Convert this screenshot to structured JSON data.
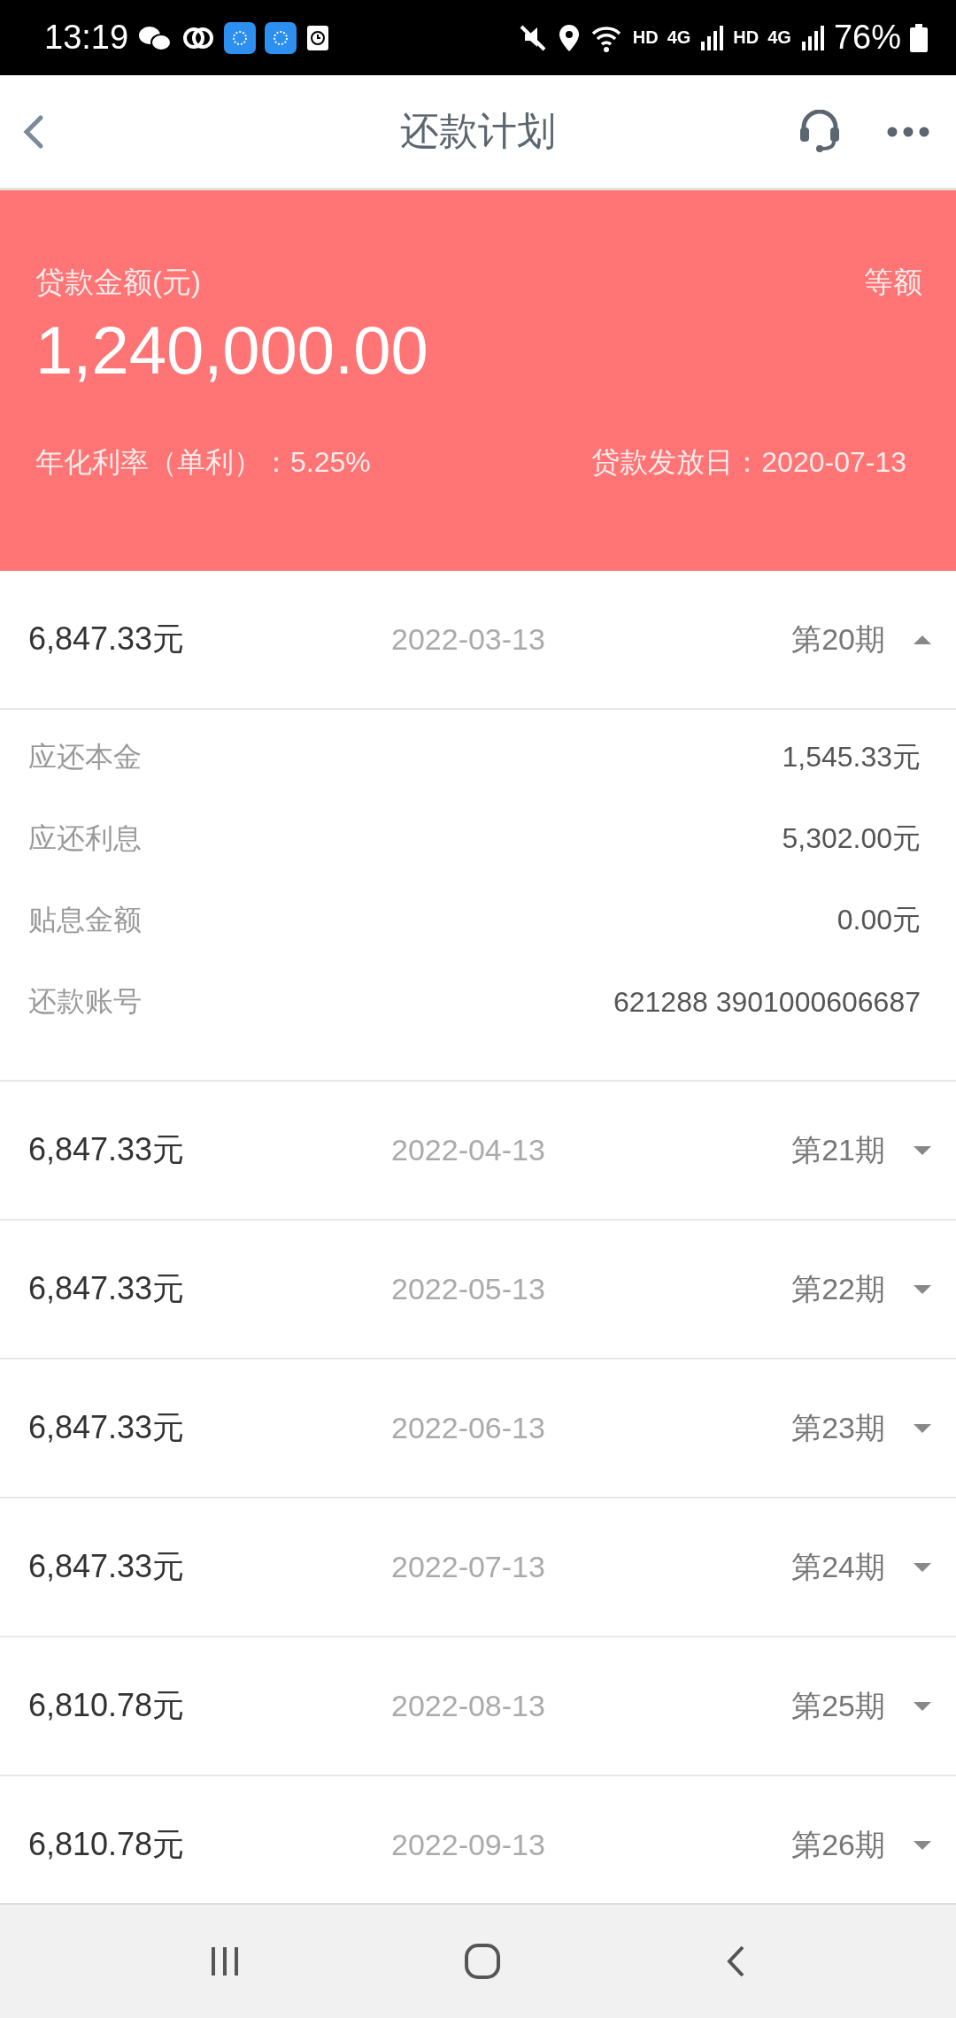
{
  "status_bar": {
    "time": "13:19",
    "network": [
      "HD",
      "4G",
      "HD",
      "4G"
    ],
    "battery": "76%"
  },
  "header": {
    "title": "还款计划"
  },
  "loan": {
    "amount_label": "贷款金额(元)",
    "amount": "1,240,000.00",
    "method": "等额",
    "rate": "年化利率（单利）：5.25%",
    "issue_date": "贷款发放日：2020-07-13"
  },
  "installments": [
    {
      "amount": "6,847.33元",
      "date": "2022-03-13",
      "period": "第20期",
      "expanded": true,
      "details": [
        {
          "label": "应还本金",
          "value": "1,545.33元"
        },
        {
          "label": "应还利息",
          "value": "5,302.00元"
        },
        {
          "label": "贴息金额",
          "value": "0.00元"
        },
        {
          "label": "还款账号",
          "value": "621288 3901000606687"
        }
      ]
    },
    {
      "amount": "6,847.33元",
      "date": "2022-04-13",
      "period": "第21期",
      "expanded": false
    },
    {
      "amount": "6,847.33元",
      "date": "2022-05-13",
      "period": "第22期",
      "expanded": false
    },
    {
      "amount": "6,847.33元",
      "date": "2022-06-13",
      "period": "第23期",
      "expanded": false
    },
    {
      "amount": "6,847.33元",
      "date": "2022-07-13",
      "period": "第24期",
      "expanded": false
    },
    {
      "amount": "6,810.78元",
      "date": "2022-08-13",
      "period": "第25期",
      "expanded": false
    },
    {
      "amount": "6,810.78元",
      "date": "2022-09-13",
      "period": "第26期",
      "expanded": false
    }
  ]
}
